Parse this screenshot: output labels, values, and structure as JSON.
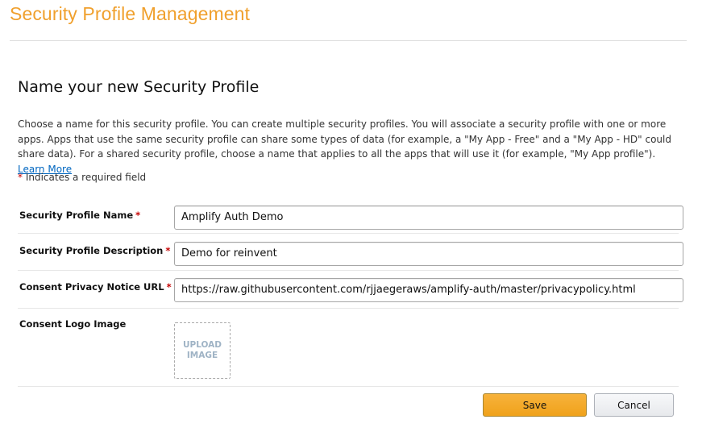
{
  "page": {
    "title": "Security Profile Management"
  },
  "section": {
    "heading": "Name your new Security Profile",
    "intro_text": "Choose a name for this security profile. You can create multiple security profiles. You will associate a security profile with one or more apps. Apps that use the same security profile can share some types of data (for example, a \"My App - Free\" and a \"My App - HD\" could share data). For a shared security profile, choose a name that applies to all the apps that will use it (for example, \"My App profile\").",
    "learn_more_link": "Learn More",
    "required_star": "*",
    "required_note": " Indicates a required field"
  },
  "form": {
    "profile_name": {
      "label": "Security Profile Name",
      "required_star": "*",
      "value": "Amplify Auth Demo"
    },
    "profile_description": {
      "label": "Security Profile Description",
      "required_star": "*",
      "value": "Demo for reinvent"
    },
    "privacy_url": {
      "label": "Consent Privacy Notice URL",
      "required_star": "*",
      "value": "https://raw.githubusercontent.com/rjjaegeraws/amplify-auth/master/privacypolicy.html"
    },
    "logo_image": {
      "label": "Consent Logo Image",
      "upload_label_line1": "UPLOAD",
      "upload_label_line2": "IMAGE"
    }
  },
  "actions": {
    "save_label": "Save",
    "cancel_label": "Cancel"
  },
  "colors": {
    "title_accent": "#f0a02d",
    "required_star": "#c40000",
    "link": "#0066c0",
    "save_button": "#f0a21b"
  }
}
